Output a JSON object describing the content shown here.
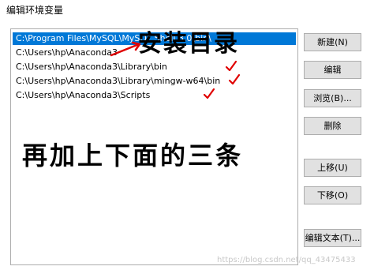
{
  "window": {
    "title": "编辑环境变量"
  },
  "path_list": {
    "items": [
      "C:\\Program Files\\MySQL\\MySQL Shell 8.0\\bin\\",
      "C:\\Users\\hp\\Anaconda3",
      "C:\\Users\\hp\\Anaconda3\\Library\\bin",
      "C:\\Users\\hp\\Anaconda3\\Library\\mingw-w64\\bin",
      "C:\\Users\\hp\\Anaconda3\\Scripts"
    ],
    "selected_index": 0
  },
  "buttons": {
    "new": "新建(N)",
    "edit": "编辑",
    "browse": "浏览(B)...",
    "delete": "删除",
    "move_up": "上移(U)",
    "move_down": "下移(O)",
    "edit_text": "编辑文本(T)..."
  },
  "annotations": {
    "install_dir": "安装目录",
    "add_four": "再加上下面的三条",
    "mark_color": "#e00000"
  },
  "watermark": "https://blog.csdn.net/qq_43475433"
}
